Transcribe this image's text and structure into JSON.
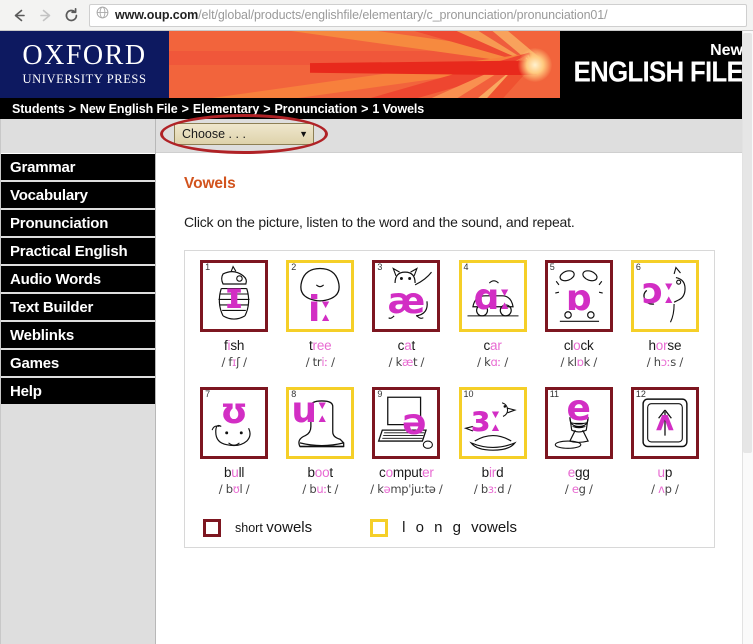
{
  "browser": {
    "back_icon": "back-arrow-icon",
    "forward_icon": "forward-arrow-icon",
    "reload_icon": "reload-icon",
    "site_icon": "globe-icon",
    "url_domain": "www.oup.com",
    "url_path": "/elt/global/products/englishfile/elementary/c_pronunciation/pronunciation01/"
  },
  "banner": {
    "publisher_line1": "OXFORD",
    "publisher_line2": "UNIVERSITY PRESS",
    "product_new": "New",
    "product_title": "ENGLISH FILE"
  },
  "breadcrumb": {
    "items": [
      "Students",
      "New English File",
      "Elementary",
      "Pronunciation",
      "1 Vowels"
    ],
    "separator": ">"
  },
  "chooser": {
    "value": "Choose . . .",
    "arrow": "▼",
    "annotation": "red-ellipse-highlight"
  },
  "sidebar": {
    "items": [
      {
        "label": "Grammar"
      },
      {
        "label": "Vocabulary"
      },
      {
        "label": "Pronunciation"
      },
      {
        "label": "Practical English"
      },
      {
        "label": "Audio Words"
      },
      {
        "label": "Text Builder"
      },
      {
        "label": "Weblinks"
      },
      {
        "label": "Games"
      },
      {
        "label": "Help"
      }
    ]
  },
  "main": {
    "title": "Vowels",
    "instruction": "Click on the picture, listen to the word and the sound, and repeat."
  },
  "grid": {
    "row1": [
      {
        "num": "1",
        "symbol": "ɪ",
        "word_pre": "f",
        "word_v": "i",
        "word_post": "sh",
        "phon_pre": "/ f",
        "phon_v": "ɪ",
        "phon_post": "ʃ /",
        "type": "short"
      },
      {
        "num": "2",
        "symbol": "iː",
        "word_pre": "t",
        "word_v": "ree",
        "word_post": "",
        "phon_pre": "/ tr",
        "phon_v": "iː",
        "phon_post": " /",
        "type": "long"
      },
      {
        "num": "3",
        "symbol": "æ",
        "word_pre": "c",
        "word_v": "a",
        "word_post": "t",
        "phon_pre": "/ k",
        "phon_v": "æ",
        "phon_post": "t /",
        "type": "short"
      },
      {
        "num": "4",
        "symbol": "ɑː",
        "word_pre": "c",
        "word_v": "ar",
        "word_post": "",
        "phon_pre": "/ k",
        "phon_v": "ɑː",
        "phon_post": " /",
        "type": "long"
      },
      {
        "num": "5",
        "symbol": "ɒ",
        "word_pre": "cl",
        "word_v": "o",
        "word_post": "ck",
        "phon_pre": "/ kl",
        "phon_v": "ɒ",
        "phon_post": "k /",
        "type": "short"
      },
      {
        "num": "6",
        "symbol": "ɔː",
        "word_pre": "h",
        "word_v": "or",
        "word_post": "se",
        "phon_pre": "/ h",
        "phon_v": "ɔː",
        "phon_post": "s /",
        "type": "long"
      }
    ],
    "row2": [
      {
        "num": "7",
        "symbol": "ʊ",
        "word_pre": "b",
        "word_v": "u",
        "word_post": "ll",
        "phon_pre": "/ b",
        "phon_v": "ʊ",
        "phon_post": "l /",
        "type": "short"
      },
      {
        "num": "8",
        "symbol": "uː",
        "word_pre": "b",
        "word_v": "oo",
        "word_post": "t",
        "phon_pre": "/ b",
        "phon_v": "uː",
        "phon_post": "t /",
        "type": "long"
      },
      {
        "num": "9",
        "symbol": "ə",
        "word_pre": "c",
        "word_v": "o",
        "word_post": "mput",
        "word_post2": "er",
        "phon_pre": "/ k",
        "phon_v": "ə",
        "phon_post": "mpˈjuːtə /",
        "type": "short"
      },
      {
        "num": "10",
        "symbol": "ɜː",
        "word_pre": "b",
        "word_v": "ir",
        "word_post": "d",
        "phon_pre": "/ b",
        "phon_v": "ɜː",
        "phon_post": "d /",
        "type": "long"
      },
      {
        "num": "11",
        "symbol": "e",
        "word_pre": "",
        "word_v": "e",
        "word_post": "gg",
        "phon_pre": "/ ",
        "phon_v": "e",
        "phon_post": "g /",
        "type": "short"
      },
      {
        "num": "12",
        "symbol": "ʌ",
        "word_pre": "",
        "word_v": "u",
        "word_post": "p",
        "phon_pre": "/ ",
        "phon_v": "ʌ",
        "phon_post": "p /",
        "type": "short"
      }
    ]
  },
  "legend": {
    "short_label_small": "short",
    "short_label_big": "vowels",
    "long_label_spaced": "l o n g",
    "long_label_big": "vowels"
  },
  "colors": {
    "short_border": "#7d1620",
    "long_border": "#f5cf28",
    "heading": "#d2531d",
    "symbol_pink": "#d22ec4",
    "vowel_pink": "#e86bd2",
    "oup_navy": "#0d1960",
    "annotation_red": "#b02226"
  }
}
